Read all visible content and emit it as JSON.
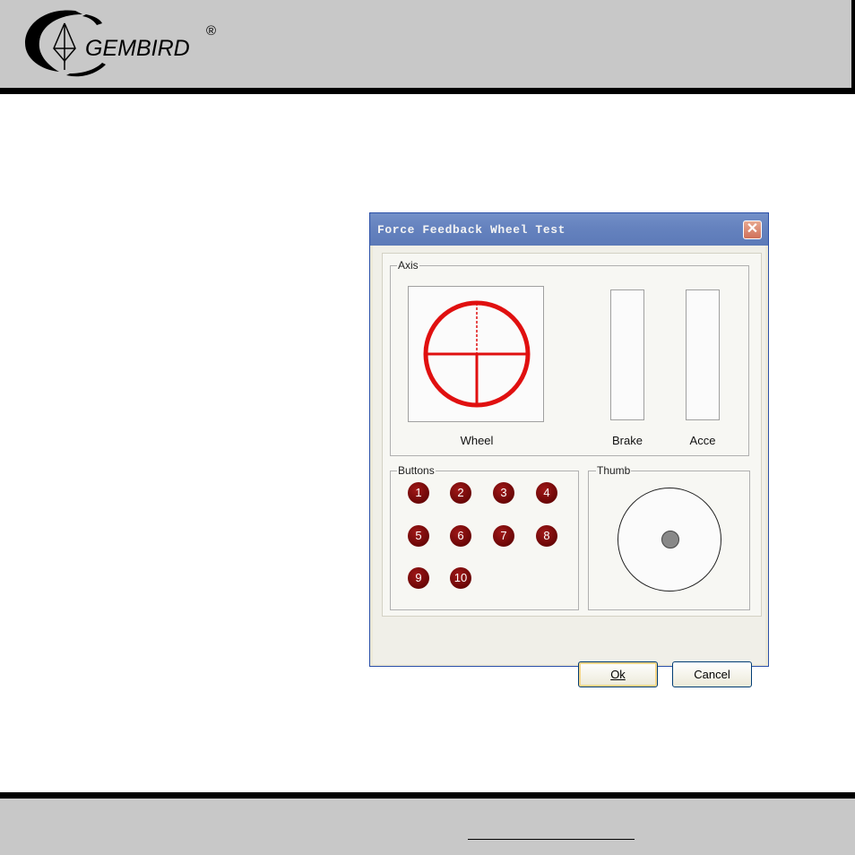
{
  "header": {
    "logo_text": "GEMBIRD",
    "logo_reg": "®"
  },
  "dialog": {
    "title": "Force Feedback Wheel Test",
    "close_glyph": "✕",
    "axis": {
      "label": "Axis",
      "wheel_label": "Wheel",
      "brake_label": "Brake",
      "acce_label": "Acce"
    },
    "buttons": {
      "label": "Buttons",
      "items": [
        "1",
        "2",
        "3",
        "4",
        "5",
        "6",
        "7",
        "8",
        "9",
        "10"
      ]
    },
    "thumb": {
      "label": "Thumb"
    },
    "ok_label": "Ok",
    "cancel_label": "Cancel"
  },
  "colors": {
    "wheel_red": "#e01010",
    "button_red": "#7a0808",
    "titlebar": "#6683bf"
  },
  "icons": {
    "logo": "gembird-logo",
    "close": "close-icon",
    "wheel": "crosshair-circle-icon"
  }
}
